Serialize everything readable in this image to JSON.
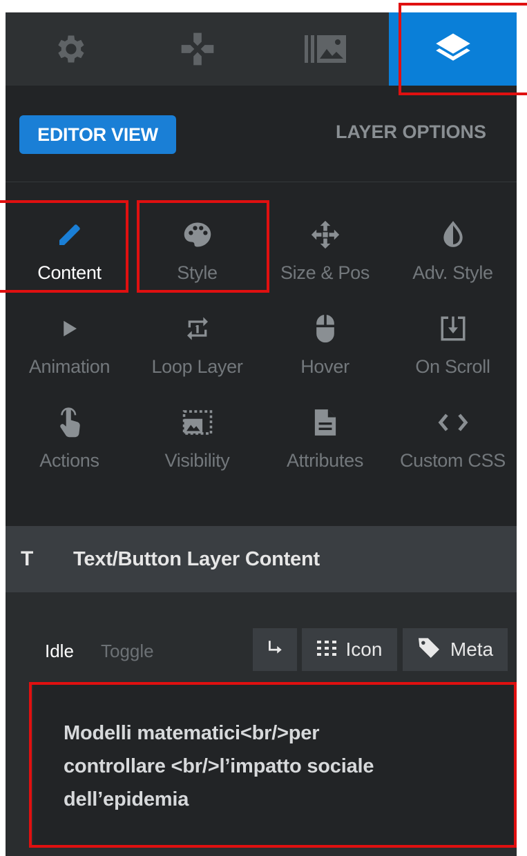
{
  "top_tabs": [
    {
      "icon": "gear-icon",
      "active": false
    },
    {
      "icon": "gamepad-icon",
      "active": false
    },
    {
      "icon": "media-library-icon",
      "active": false
    },
    {
      "icon": "layers-icon",
      "active": true
    }
  ],
  "header": {
    "editor_view_label": "EDITOR VIEW",
    "layer_options_label": "LAYER OPTIONS"
  },
  "options": [
    {
      "label": "Content",
      "icon": "pencil-icon",
      "active": true
    },
    {
      "label": "Style",
      "icon": "palette-icon",
      "active": false
    },
    {
      "label": "Size & Pos",
      "icon": "move-arrows-icon",
      "active": false
    },
    {
      "label": "Adv. Style",
      "icon": "contrast-icon",
      "active": false
    },
    {
      "label": "Animation",
      "icon": "play-icon",
      "active": false
    },
    {
      "label": "Loop Layer",
      "icon": "loop-icon",
      "active": false
    },
    {
      "label": "Hover",
      "icon": "mouse-icon",
      "active": false
    },
    {
      "label": "On Scroll",
      "icon": "scroll-download-icon",
      "active": false
    },
    {
      "label": "Actions",
      "icon": "hand-pointer-icon",
      "active": false
    },
    {
      "label": "Visibility",
      "icon": "visibility-image-icon",
      "active": false
    },
    {
      "label": "Attributes",
      "icon": "file-icon",
      "active": false
    },
    {
      "label": "Custom CSS",
      "icon": "code-icon",
      "active": false
    }
  ],
  "section": {
    "icon_glyph": "T",
    "title": "Text/Button Layer Content"
  },
  "content": {
    "state_idle": "Idle",
    "state_toggle": "Toggle",
    "icon_button_label": "Icon",
    "meta_button_label": "Meta",
    "text_lines": [
      "Modelli matematici<br/>per",
      "controllare <br/>l’impatto sociale",
      "dell’epidemia"
    ]
  },
  "colors": {
    "accent": "#0a7fd8",
    "panel_bg": "#222426",
    "highlight": "#e01010"
  }
}
